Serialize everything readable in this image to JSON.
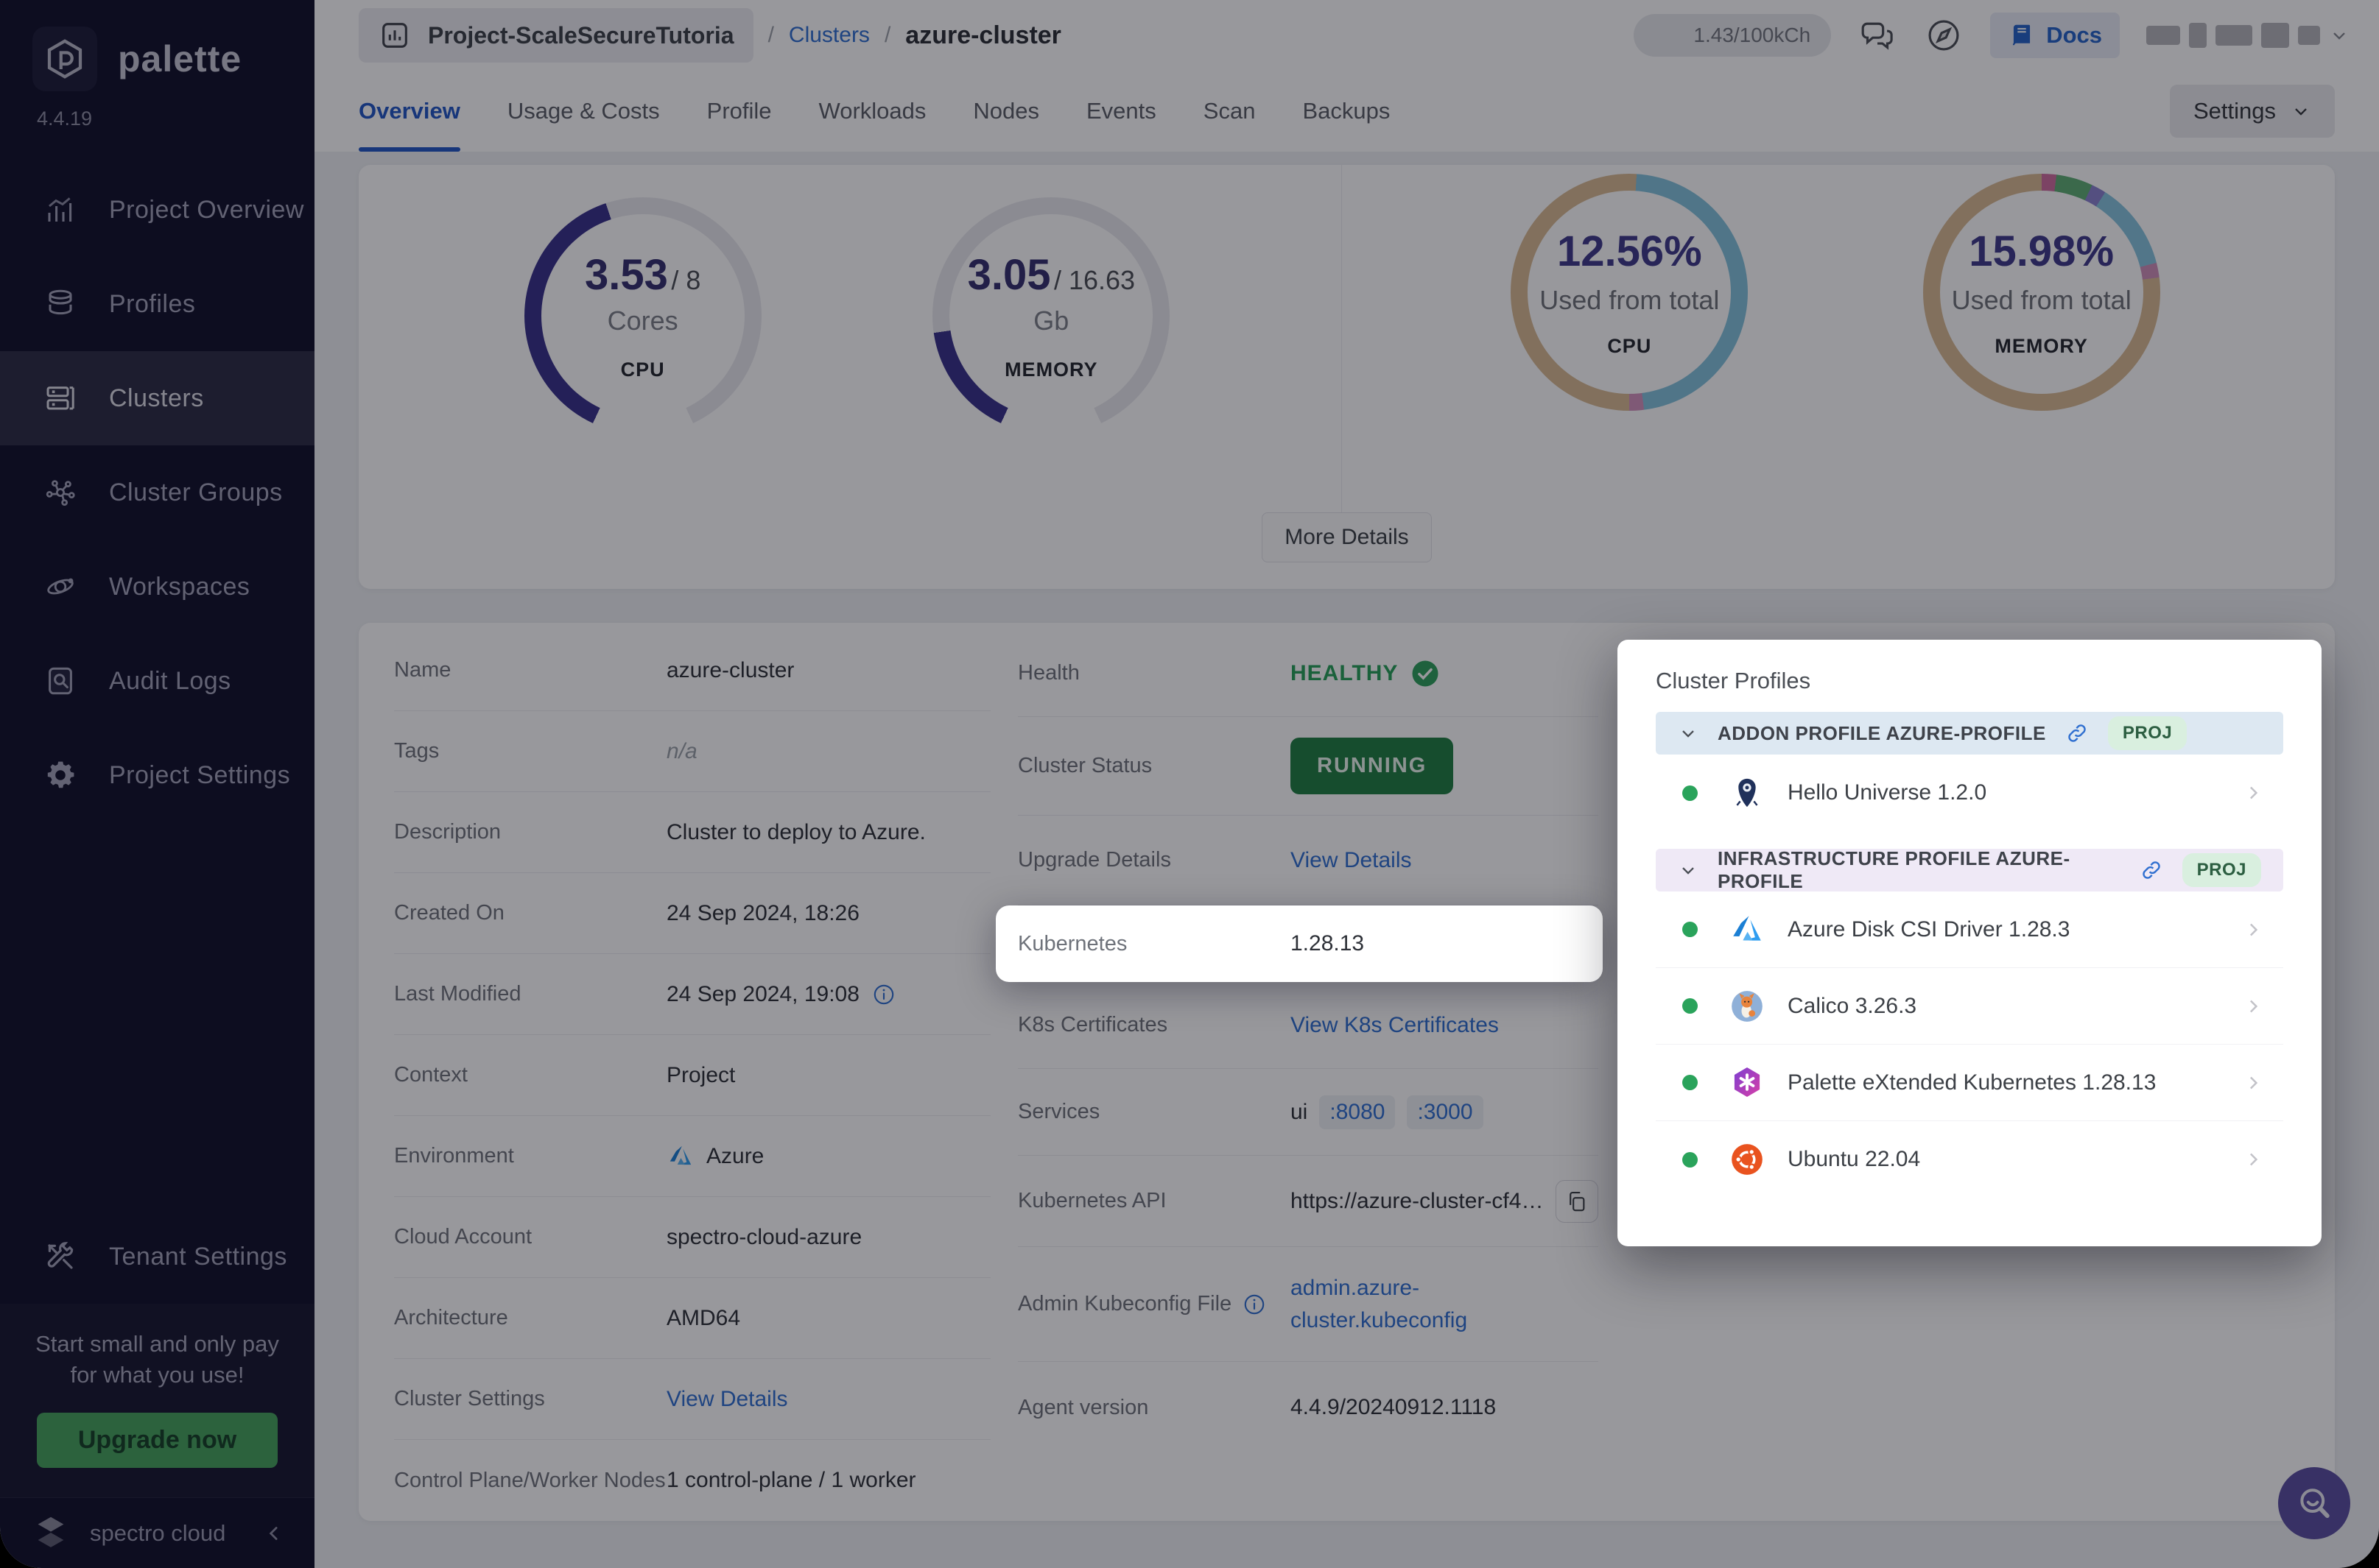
{
  "sidebar": {
    "logo_text": "palette",
    "version": "4.4.19",
    "items": [
      {
        "label": "Project Overview",
        "icon": "bar-chart-icon",
        "active": false
      },
      {
        "label": "Profiles",
        "icon": "layers-icon",
        "active": false
      },
      {
        "label": "Clusters",
        "icon": "server-icon",
        "active": true
      },
      {
        "label": "Cluster Groups",
        "icon": "network-icon",
        "active": false
      },
      {
        "label": "Workspaces",
        "icon": "orbit-icon",
        "active": false
      },
      {
        "label": "Audit Logs",
        "icon": "audit-doc-icon",
        "active": false
      },
      {
        "label": "Project Settings",
        "icon": "gear-icon",
        "active": false
      }
    ],
    "tenant_settings_label": "Tenant Settings",
    "promo": {
      "line1": "Start small and only pay",
      "line2": "for what you use!",
      "button_label": "Upgrade now"
    },
    "footer_brand": "spectro cloud"
  },
  "header": {
    "project_pill_label": "Project-ScaleSecureTutoria",
    "breadcrumb_section": "Clusters",
    "breadcrumb_sep1": "/",
    "breadcrumb_sep2": "/",
    "breadcrumb_current": "azure-cluster",
    "usage_pill": "1.43/100kCh",
    "docs_label": "Docs"
  },
  "tabs": {
    "items": [
      "Overview",
      "Usage & Costs",
      "Profile",
      "Workloads",
      "Nodes",
      "Events",
      "Scan",
      "Backups"
    ],
    "active": "Overview",
    "settings_button_label": "Settings"
  },
  "overview": {
    "gauges": [
      {
        "value": "3.53",
        "total": "/ 8",
        "unit": "Cores",
        "label": "CPU",
        "fraction": 0.441
      },
      {
        "value": "3.05",
        "total": "/ 16.63",
        "unit": "Gb",
        "label": "MEMORY",
        "fraction": 0.183
      }
    ],
    "rings": [
      {
        "percent": "12.56%",
        "caption": "Used from total",
        "label": "CPU",
        "segments": [
          {
            "color": "#d9ba93",
            "pct": 1
          },
          {
            "color": "#84c3dc",
            "pct": 47
          },
          {
            "color": "#d493bd",
            "pct": 2
          },
          {
            "color": "#d9ba93",
            "pct": 50
          }
        ]
      },
      {
        "percent": "15.98%",
        "caption": "Used from total",
        "label": "MEMORY",
        "segments": [
          {
            "color": "#cf6d9f",
            "pct": 2
          },
          {
            "color": "#5fae74",
            "pct": 5
          },
          {
            "color": "#8a82cf",
            "pct": 2
          },
          {
            "color": "#87c4de",
            "pct": 12
          },
          {
            "color": "#cf8fb8",
            "pct": 2
          },
          {
            "color": "#d9ba93",
            "pct": 77
          }
        ]
      }
    ],
    "gauge_fill": "#38318a",
    "gauge_track": "#e9e9ee",
    "more_details_button": "More Details"
  },
  "details": {
    "left_rows": [
      {
        "label": "Name",
        "value": "azure-cluster",
        "type": "plain"
      },
      {
        "label": "Tags",
        "value": "n/a",
        "type": "muted"
      },
      {
        "label": "Description",
        "value": "Cluster to deploy to Azure.",
        "type": "plain"
      },
      {
        "label": "Created On",
        "value": "24 Sep 2024, 18:26",
        "type": "plain"
      },
      {
        "label": "Last Modified",
        "value": "24 Sep 2024, 19:08",
        "type": "info"
      },
      {
        "label": "Context",
        "value": "Project",
        "type": "plain"
      },
      {
        "label": "Environment",
        "value": "Azure",
        "type": "env"
      },
      {
        "label": "Cloud Account",
        "value": "spectro-cloud-azure",
        "type": "plain"
      },
      {
        "label": "Architecture",
        "value": "AMD64",
        "type": "plain"
      },
      {
        "label": "Cluster Settings",
        "value": "View Details",
        "type": "link"
      },
      {
        "label": "Control Plane/Worker Nodes",
        "value": "1 control-plane / 1 worker",
        "type": "plain"
      }
    ],
    "right_rows": [
      {
        "label": "Health",
        "value": "HEALTHY",
        "type": "health"
      },
      {
        "label": "Cluster Status",
        "value": "RUNNING",
        "type": "status"
      },
      {
        "label": "Upgrade Details",
        "value": "View Details",
        "type": "link"
      },
      {
        "label": "Kubernetes",
        "value": "1.28.13",
        "type": "spotlight"
      },
      {
        "label": "K8s Certificates",
        "value": "View K8s Certificates",
        "type": "link"
      },
      {
        "label": "Services",
        "prefix": "ui",
        "ports": [
          ":8080",
          ":3000"
        ],
        "type": "services"
      },
      {
        "label": "Kubernetes API",
        "value": "https://azure-cluster-cf42...",
        "type": "api"
      },
      {
        "label": "Admin Kubeconfig File",
        "value": "admin.azure-cluster.kubeconfig",
        "type": "kubeconfig"
      },
      {
        "label": "Agent version",
        "value": "4.4.9/20240912.1118",
        "type": "plain"
      }
    ]
  },
  "profiles_panel": {
    "title": "Cluster Profiles",
    "sections": [
      {
        "header": "ADDON PROFILE AZURE-PROFILE",
        "badge": "PROJ",
        "tint": "blue",
        "items": [
          {
            "name": "Hello Universe 1.2.0",
            "icon": "hello-universe-logo"
          }
        ]
      },
      {
        "header": "INFRASTRUCTURE PROFILE AZURE-PROFILE",
        "badge": "PROJ",
        "tint": "purple",
        "items": [
          {
            "name": "Azure Disk CSI Driver 1.28.3",
            "icon": "azure-logo"
          },
          {
            "name": "Calico 3.26.3",
            "icon": "calico-logo"
          },
          {
            "name": "Palette eXtended Kubernetes 1.28.13",
            "icon": "pxk-logo"
          },
          {
            "name": "Ubuntu 22.04",
            "icon": "ubuntu-logo"
          }
        ]
      }
    ]
  }
}
